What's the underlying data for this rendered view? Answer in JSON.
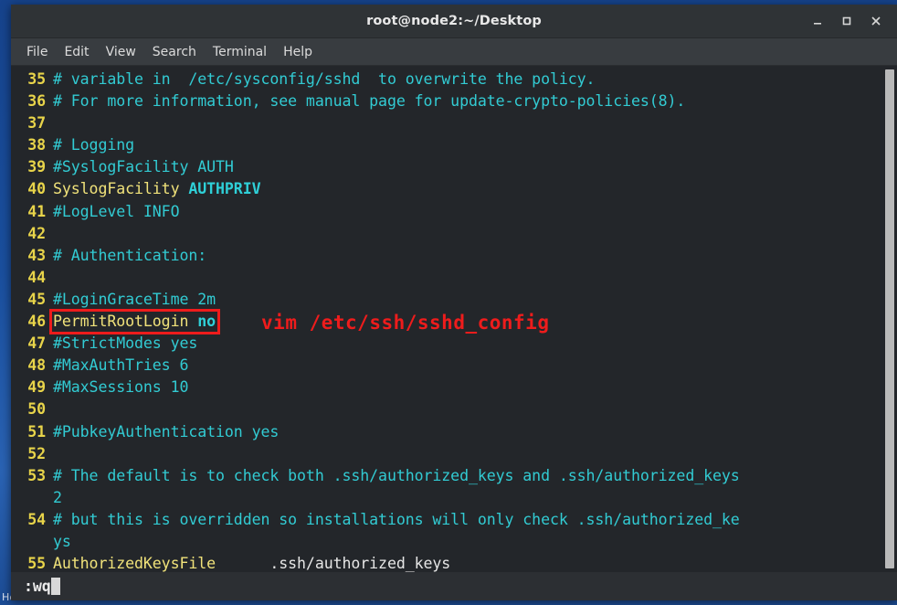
{
  "desktop": {
    "icon_label_partial": "Home"
  },
  "window": {
    "title": "root@node2:~/Desktop",
    "controls": {
      "minimize": "minimize-button",
      "maximize": "maximize-button",
      "close": "close-button"
    }
  },
  "menubar": {
    "items": [
      {
        "label": "File"
      },
      {
        "label": "Edit"
      },
      {
        "label": "View"
      },
      {
        "label": "Search"
      },
      {
        "label": "Terminal"
      },
      {
        "label": "Help"
      }
    ]
  },
  "editor": {
    "lines": [
      {
        "num": "35",
        "segments": [
          {
            "text": "# variable in  /etc/sysconfig/sshd  to overwrite the policy.",
            "cls": "cmt"
          }
        ]
      },
      {
        "num": "36",
        "segments": [
          {
            "text": "# For more information, see manual page for update-crypto-policies(8).",
            "cls": "cmt"
          }
        ]
      },
      {
        "num": "37",
        "segments": [
          {
            "text": "",
            "cls": "cmt"
          }
        ]
      },
      {
        "num": "38",
        "segments": [
          {
            "text": "# Logging",
            "cls": "cmt"
          }
        ]
      },
      {
        "num": "39",
        "segments": [
          {
            "text": "#SyslogFacility AUTH",
            "cls": "cmt"
          }
        ]
      },
      {
        "num": "40",
        "segments": [
          {
            "text": "SyslogFacility ",
            "cls": "key"
          },
          {
            "text": "AUTHPRIV",
            "cls": "val"
          }
        ]
      },
      {
        "num": "41",
        "segments": [
          {
            "text": "#LogLevel INFO",
            "cls": "cmt"
          }
        ]
      },
      {
        "num": "42",
        "segments": [
          {
            "text": "",
            "cls": "cmt"
          }
        ]
      },
      {
        "num": "43",
        "segments": [
          {
            "text": "# Authentication:",
            "cls": "cmt"
          }
        ]
      },
      {
        "num": "44",
        "segments": [
          {
            "text": "",
            "cls": "cmt"
          }
        ]
      },
      {
        "num": "45",
        "segments": [
          {
            "text": "#LoginGraceTime 2m",
            "cls": "cmt"
          }
        ]
      },
      {
        "num": "46",
        "segments": [
          {
            "text": "PermitRootLogin ",
            "cls": "key"
          },
          {
            "text": "no",
            "cls": "val"
          }
        ]
      },
      {
        "num": "47",
        "segments": [
          {
            "text": "#StrictModes yes",
            "cls": "cmt"
          }
        ]
      },
      {
        "num": "48",
        "segments": [
          {
            "text": "#MaxAuthTries 6",
            "cls": "cmt"
          }
        ]
      },
      {
        "num": "49",
        "segments": [
          {
            "text": "#MaxSessions 10",
            "cls": "cmt"
          }
        ]
      },
      {
        "num": "50",
        "segments": [
          {
            "text": "",
            "cls": "cmt"
          }
        ]
      },
      {
        "num": "51",
        "segments": [
          {
            "text": "#PubkeyAuthentication yes",
            "cls": "cmt"
          }
        ]
      },
      {
        "num": "52",
        "segments": [
          {
            "text": "",
            "cls": "cmt"
          }
        ]
      },
      {
        "num": "53",
        "segments": [
          {
            "text": "# The default is to check both .ssh/authorized_keys and .ssh/authorized_keys",
            "cls": "cmt"
          }
        ]
      },
      {
        "num": "",
        "segments": [
          {
            "text": "2",
            "cls": "cmt"
          }
        ]
      },
      {
        "num": "54",
        "segments": [
          {
            "text": "# but this is overridden so installations will only check .ssh/authorized_ke",
            "cls": "cmt"
          }
        ]
      },
      {
        "num": "",
        "segments": [
          {
            "text": "ys",
            "cls": "cmt"
          }
        ]
      },
      {
        "num": "55",
        "segments": [
          {
            "text": "AuthorizedKeysFile",
            "cls": "key"
          },
          {
            "text": "      .ssh/authorized_keys",
            "cls": "plain"
          }
        ]
      }
    ]
  },
  "statusline": {
    "command": ":wq"
  },
  "annotations": {
    "highlight_box": {
      "target": "PermitRootLogin no",
      "color": "#ee1c1c"
    },
    "callout": {
      "text": "vim /etc/ssh/sshd_config",
      "color": "#ee1c1c"
    }
  },
  "colors": {
    "terminal_background": "#23262a",
    "titlebar_background": "#2f3336",
    "menubar_background": "#383c40",
    "line_number": "#e8d44a",
    "comment": "#32cbd3",
    "keyword": "#f0e27a",
    "value": "#2fd0d8",
    "annotation_red": "#ee1c1c",
    "desktop_blue": "#1a4f9e"
  }
}
